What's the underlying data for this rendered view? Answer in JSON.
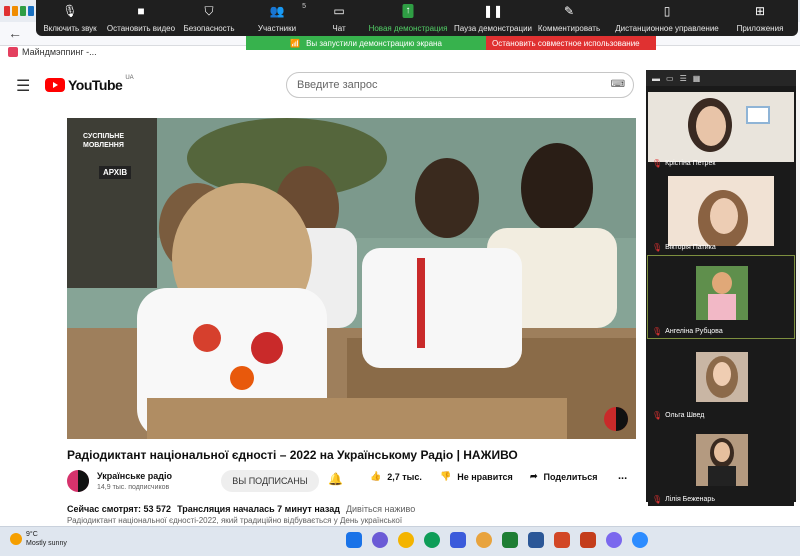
{
  "browser": {
    "bookmark_label": "Майндмэппинг -..."
  },
  "zoom_toolbar": {
    "items": [
      {
        "label": "Включить звук",
        "icon": "mic-off-icon"
      },
      {
        "label": "Остановить видео",
        "icon": "video-camera-icon"
      },
      {
        "label": "Безопасность",
        "icon": "shield-icon"
      },
      {
        "label": "Участники",
        "icon": "people-icon",
        "count": "5"
      },
      {
        "label": "Чат",
        "icon": "chat-icon"
      },
      {
        "label": "Новая демонстрация",
        "icon": "share-screen-icon"
      },
      {
        "label": "Пауза демонстрации",
        "icon": "pause-icon"
      },
      {
        "label": "Комментировать",
        "icon": "pen-icon"
      },
      {
        "label": "Дистанционное управление",
        "icon": "mouse-icon"
      },
      {
        "label": "Приложения",
        "icon": "apps-icon"
      }
    ],
    "sharing_status": "Вы запустили демонстрацию экрана",
    "stop_sharing": "Остановить совместное использование"
  },
  "youtube": {
    "logo_text": "YouTube",
    "region": "UA",
    "search_placeholder": "Введите запрос",
    "video": {
      "logo_line1": "СУСПІЛЬНЕ",
      "logo_line2": "МОВЛЕННЯ",
      "archive_badge": "АРХІВ"
    },
    "title": "Радіодиктант національної єдності – 2022 на Українському Радіо | НАЖИВО",
    "channel": {
      "name": "Українське радіо",
      "subscribers": "14,9 тыс. подписчиков"
    },
    "subscribe_label": "ВЫ ПОДПИСАНЫ",
    "like_count": "2,7 тыс.",
    "dislike_label": "Не нравится",
    "share_label": "Поделиться",
    "more_label": "...",
    "viewers": "Сейчас смотрят: 53 572",
    "started": "Трансляция началась 7 минут назад",
    "watch_live": "Дивіться наживо",
    "description": "Радіодиктант національної єдності-2022, який традиційно відбувається у День української"
  },
  "participants": [
    {
      "name": "Крістіна Петрек"
    },
    {
      "name": "Вікторія Патика"
    },
    {
      "name": "Ангеліна Рубцова"
    },
    {
      "name": "Ольга Швед"
    },
    {
      "name": "Лілія Беженарь"
    }
  ],
  "taskbar": {
    "temperature": "9°C",
    "weather_desc": "Mostly sunny"
  }
}
